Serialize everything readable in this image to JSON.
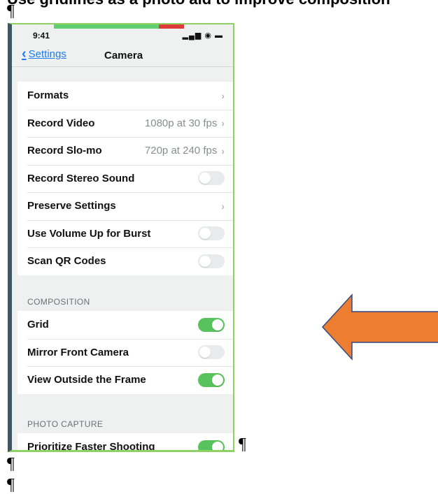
{
  "document": {
    "heading": "Use gridlines as a photo aid to improve composition",
    "pilcrow": "¶"
  },
  "phone": {
    "status_time": "9:41",
    "status_icons": "▂▄▆ ◉ ▬",
    "nav": {
      "back_label": "Settings",
      "title": "Camera"
    },
    "group1": [
      {
        "label": "Formats",
        "type": "link"
      },
      {
        "label": "Record Video",
        "value": "1080p at 30 fps",
        "type": "link"
      },
      {
        "label": "Record Slo-mo",
        "value": "720p at 240 fps",
        "type": "link"
      },
      {
        "label": "Record Stereo Sound",
        "type": "toggle",
        "on": false
      },
      {
        "label": "Preserve Settings",
        "type": "link"
      },
      {
        "label": "Use Volume Up for Burst",
        "type": "toggle",
        "on": false
      },
      {
        "label": "Scan QR Codes",
        "type": "toggle",
        "on": false
      }
    ],
    "composition_header": "COMPOSITION",
    "group2": [
      {
        "label": "Grid",
        "type": "toggle",
        "on": true
      },
      {
        "label": "Mirror Front Camera",
        "type": "toggle",
        "on": false
      },
      {
        "label": "View Outside the Frame",
        "type": "toggle",
        "on": true
      }
    ],
    "photo_capture_header": "PHOTO CAPTURE",
    "group3": [
      {
        "label": "Prioritize Faster Shooting",
        "type": "toggle",
        "on": true
      }
    ]
  },
  "colors": {
    "arrow_fill": "#ed7d31",
    "arrow_stroke": "#2f4b7c",
    "toggle_on": "#56c35c",
    "link_blue": "#1d7bf0"
  }
}
